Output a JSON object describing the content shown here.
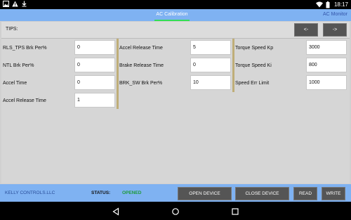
{
  "statusbar": {
    "time": "18:17",
    "left_icons": [
      "image-icon",
      "warning-icon",
      "download-icon"
    ],
    "right_icons": [
      "wifi-icon",
      "battery-icon"
    ]
  },
  "tabs": [
    {
      "label": "AC Calibration",
      "active": true
    },
    {
      "label": "AC Monitor",
      "active": false
    }
  ],
  "tips": {
    "label": "TIPS:",
    "prev_label": "<-",
    "next_label": "->"
  },
  "columns": [
    {
      "fields": [
        {
          "label": "RLS_TPS Brk Per%",
          "value": "0"
        },
        {
          "label": "NTL Brk Per%",
          "value": "0"
        },
        {
          "label": "Accel Time",
          "value": "0"
        },
        {
          "label": "Accel Release Time",
          "value": "1"
        }
      ]
    },
    {
      "fields": [
        {
          "label": "Accel Release Time",
          "value": "5"
        },
        {
          "label": "Brake Release Time",
          "value": "0"
        },
        {
          "label": "BRK_SW Brk Per%",
          "value": "10"
        }
      ]
    },
    {
      "fields": [
        {
          "label": "Torque Speed Kp",
          "value": "3000"
        },
        {
          "label": "Torque Speed Ki",
          "value": "800"
        },
        {
          "label": "Speed Err Limit",
          "value": "1000"
        }
      ]
    }
  ],
  "bottombar": {
    "company": "KELLY CONTROLS.LLC",
    "status_label": "STATUS:",
    "status_value": "OPENED",
    "status_color": "#1e9a3a",
    "open_label": "OPEN DEVICE",
    "close_label": "CLOSE DEVICE",
    "read_label": "READ",
    "write_label": "WRITE"
  },
  "navbar": {
    "icons": [
      "back-icon",
      "home-icon",
      "recents-icon"
    ]
  },
  "colors": {
    "tab_bar": "#7fb2f2",
    "active_tab_indicator": "#33dd55",
    "button_bg": "#555555"
  }
}
